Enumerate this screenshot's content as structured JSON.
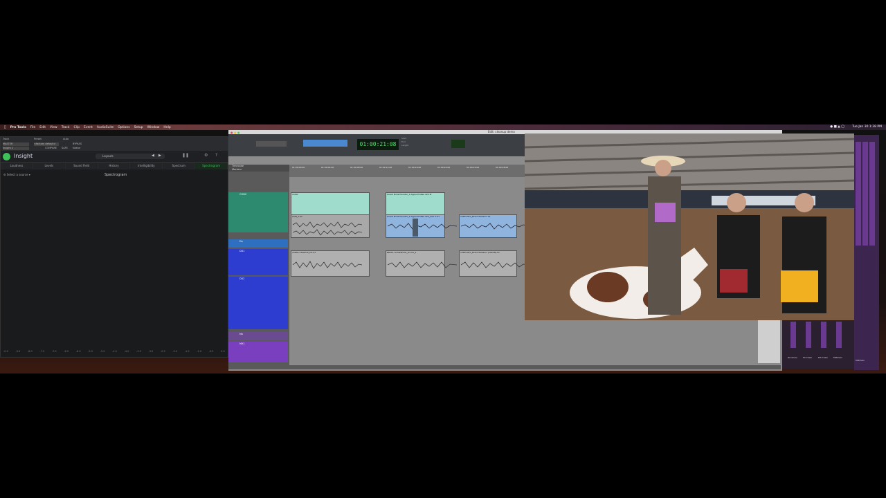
{
  "menubar": {
    "app": "Pro Tools",
    "items": [
      "File",
      "Edit",
      "View",
      "Track",
      "Clip",
      "Event",
      "AudioSuite",
      "Options",
      "Setup",
      "Window",
      "Help"
    ],
    "clock": "Tue Jan 30  1:38 PM"
  },
  "insight": {
    "header_labels": [
      "Track",
      "Preset",
      "Auto",
      "MASTER",
      "<factory default>",
      "BYPASS",
      "Insight 2",
      "COMPARE",
      "SAFE",
      "Native"
    ],
    "app_name": "Insight",
    "layouts_label": "Layouts",
    "tabs": [
      "Loudness",
      "Levels",
      "Sound Field",
      "History",
      "Intelligibility",
      "Spectrum",
      "Spectrogram"
    ],
    "active_tab": "Spectrogram",
    "source_label": "Select a source",
    "panel_title": "Spectrogram",
    "scale": [
      "-0.0",
      "-9.0",
      "-8.0",
      "-7.5",
      "-7.0",
      "-6.5",
      "-6.0",
      "-5.5",
      "-5.0",
      "-4.5",
      "-4.0",
      "-3.5",
      "-3.0",
      "-2.5",
      "-2.0",
      "-1.5",
      "-1.0",
      "-0.5",
      "0.0"
    ]
  },
  "protools": {
    "window_title": "Edit: cleanup demo",
    "counter": "01:00:21:08",
    "sel_labels": [
      "Start",
      "End",
      "Length"
    ],
    "timeline_label": "Timecode",
    "markers_label": "Markers",
    "ruler_ticks": [
      "01:00:00:00",
      "01:00:04:00",
      "01:00:08:00",
      "01:00:12:00",
      "01:00:16:00",
      "01:00:20:00",
      "01:00:24:00",
      "01:00:28:00"
    ],
    "tracks": [
      {
        "name": "CONV",
        "color": "#37a588"
      },
      {
        "name": "Dx",
        "color": "#2f6fbf"
      },
      {
        "name": "DX1",
        "color": "#2f3fbf"
      },
      {
        "name": "DX2",
        "color": "#2f3fbf"
      },
      {
        "name": "Mx",
        "color": "#7a3fbf"
      },
      {
        "name": "MX1",
        "color": "#7a3fbf"
      }
    ],
    "clips": [
      {
        "label": "CONV",
        "lane": "green"
      },
      {
        "label": "Guest Pickerhooster_1.Apple ProRes 422 IP",
        "lane": "green"
      },
      {
        "label": "CON_1.01",
        "lane": "wave"
      },
      {
        "label": "Guest Pickerhooster_1.Apple ProRes 422_Folk 2-01",
        "lane": "wave"
      },
      {
        "label": "1080 INTV_Brent Williams-01",
        "lane": "wave"
      },
      {
        "label": "1080S CalePont_Dx-01",
        "lane": "blue"
      },
      {
        "label": "BROLL GuestPicker_Dx-01_1",
        "lane": "blue"
      },
      {
        "label": "1080 INTV_Brent Williams (CLEAN)-01",
        "lane": "blue"
      }
    ]
  },
  "mixer": {
    "strip_labels": [
      "DX Chain",
      "FX Chain",
      "MX Chain",
      "MXChain",
      "MXChain"
    ]
  }
}
